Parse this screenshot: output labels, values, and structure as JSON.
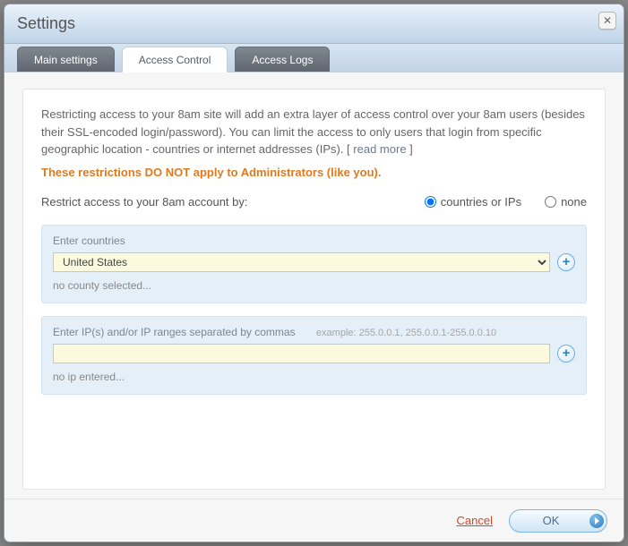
{
  "title": "Settings",
  "tabs": [
    {
      "label": "Main settings"
    },
    {
      "label": "Access Control"
    },
    {
      "label": "Access Logs"
    }
  ],
  "intro_text": "Restricting access to your 8am site will add an extra layer of access control over your 8am users (besides their SSL-encoded login/password). You can limit the access to only users that login from specific geographic location - countries or internet addresses (IPs). [ ",
  "intro_link": "read more",
  "intro_after": " ]",
  "warning": "These restrictions DO NOT apply to Administrators (like you).",
  "restrict_label": "Restrict access to your 8am account by:",
  "radios": {
    "opt1": "countries or IPs",
    "opt2": "none"
  },
  "countries": {
    "label": "Enter countries",
    "selected": "United States",
    "empty": "no county selected..."
  },
  "ips": {
    "label": "Enter IP(s) and/or IP ranges separated by commas",
    "example": "example: 255.0.0.1, 255.0.0.1-255.0.0.10",
    "value": "",
    "empty": "no ip entered..."
  },
  "footer": {
    "cancel": "Cancel",
    "ok": "OK"
  }
}
